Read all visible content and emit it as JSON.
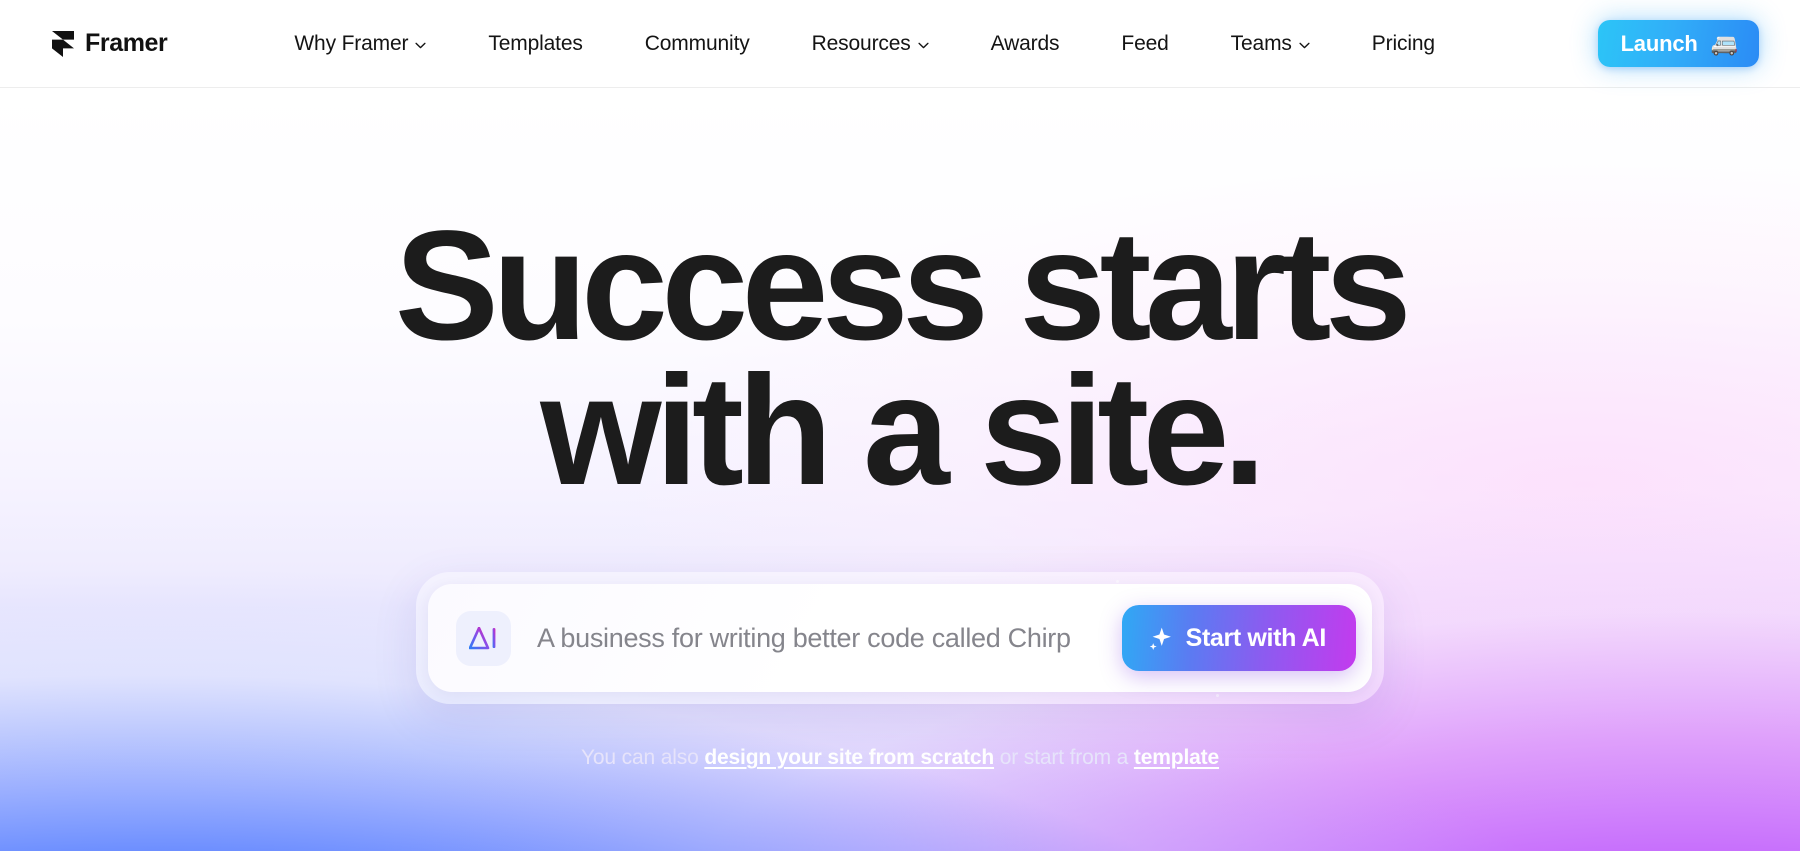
{
  "brand": {
    "name": "Framer",
    "logo_icon": "framer-logo-icon"
  },
  "nav": {
    "links": [
      {
        "label": "Why Framer",
        "has_dropdown": true
      },
      {
        "label": "Templates",
        "has_dropdown": false
      },
      {
        "label": "Community",
        "has_dropdown": false
      },
      {
        "label": "Resources",
        "has_dropdown": true
      },
      {
        "label": "Awards",
        "has_dropdown": false
      },
      {
        "label": "Feed",
        "has_dropdown": false
      },
      {
        "label": "Teams",
        "has_dropdown": true
      },
      {
        "label": "Pricing",
        "has_dropdown": false
      }
    ],
    "launch": {
      "label": "Launch",
      "emoji": "🚐",
      "gradient_from": "#2CC5F7",
      "gradient_to": "#2B8BF5"
    }
  },
  "hero": {
    "headline_line1": "Success starts",
    "headline_line2": "with a site.",
    "headline_color": "#1c1c1c",
    "prompt": {
      "ai_icon": "ai-triangle-icon",
      "value": "A business for writing better code called Chirp",
      "placeholder": "A business for writing better code called Chirp",
      "cta_label": "Start with AI",
      "cta_icon": "sparkle-icon",
      "cta_gradient_from": "#2FA9F5",
      "cta_gradient_to": "#C33BEE"
    },
    "subline": {
      "prefix": "You can also ",
      "link1": "design your site from scratch",
      "middle": " or start from a ",
      "link2": "template"
    }
  },
  "theme": {
    "background_blue": "#0B52FF",
    "background_purple": "#C252FF",
    "background_pink": "#FDDEFC",
    "nav_border": "#ededed",
    "prompt_text_color": "#85858c"
  }
}
